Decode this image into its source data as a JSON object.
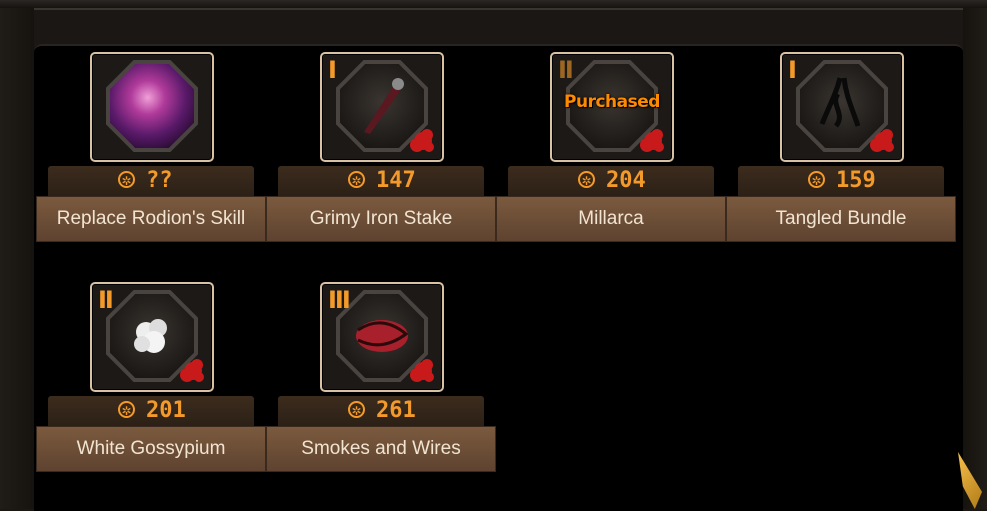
{
  "items": [
    {
      "name": "Replace Rodion's Skill",
      "price": "??",
      "tier": "",
      "purchased": false,
      "kind": "portrait"
    },
    {
      "name": "Grimy Iron Stake",
      "price": "147",
      "tier": "I",
      "purchased": false,
      "kind": "stake"
    },
    {
      "name": "Millarca",
      "price": "204",
      "tier": "II",
      "purchased": true,
      "purchased_label": "Purchased",
      "kind": "relic"
    },
    {
      "name": "Tangled Bundle",
      "price": "159",
      "tier": "I",
      "purchased": false,
      "kind": "bundle"
    },
    {
      "name": "White Gossypium",
      "price": "201",
      "tier": "II",
      "purchased": false,
      "kind": "cotton"
    },
    {
      "name": "Smokes and Wires",
      "price": "261",
      "tier": "III",
      "purchased": false,
      "kind": "wires"
    }
  ],
  "currency_icon": "cog-coin-icon",
  "colors": {
    "accent": "#f39a2a",
    "name_bar": "#6d4f37",
    "seal": "#c81a1a"
  }
}
